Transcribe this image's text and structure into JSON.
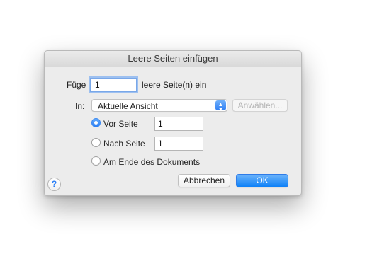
{
  "dialog": {
    "title": "Leere Seiten einfügen"
  },
  "insert": {
    "prefix_label": "Füge",
    "count_value": "1",
    "suffix_label": "leere Seite(n) ein"
  },
  "location": {
    "in_label": "In:",
    "popup_selected": "Aktuelle Ansicht",
    "choose_button": "Anwählen...",
    "options": [
      {
        "label": "Vor Seite",
        "checked": true,
        "page_value": "1"
      },
      {
        "label": "Nach Seite",
        "checked": false,
        "page_value": "1"
      },
      {
        "label": "Am Ende des Dokuments",
        "checked": false
      }
    ]
  },
  "buttons": {
    "help": "?",
    "cancel": "Abbrechen",
    "ok": "OK"
  },
  "colors": {
    "accent": "#2f7ef4",
    "dialog_bg": "#ececec"
  },
  "icons": {
    "popup_arrows": "chevron-up-down-icon",
    "help": "help-icon"
  }
}
